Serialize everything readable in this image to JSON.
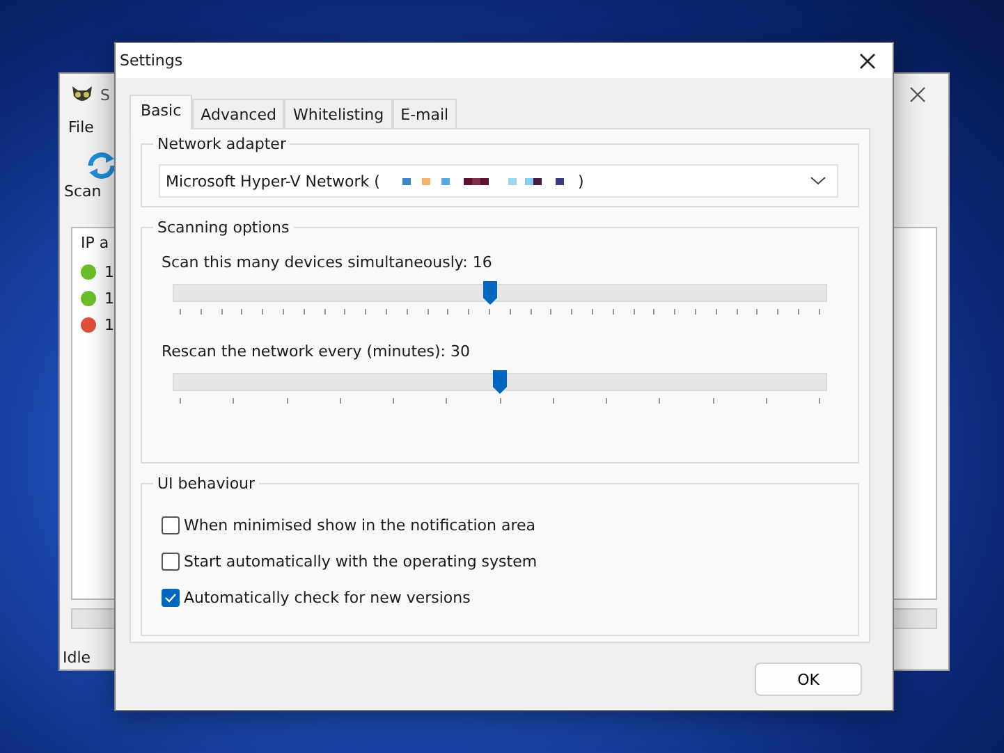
{
  "back_window": {
    "title": "S",
    "menu": [
      "File"
    ],
    "toolbar": {
      "label": "Scan"
    },
    "list": {
      "column_1": "IP a",
      "rows": [
        {
          "text": "1",
          "color": "#6cbf2a"
        },
        {
          "text": "1",
          "color": "#6cbf2a"
        },
        {
          "text": "1",
          "color": "#e0513c"
        }
      ]
    },
    "progress": {
      "level": 0
    },
    "status_bar": "Idle"
  },
  "dialog": {
    "title": "Settings",
    "tabs": [
      {
        "label": "Basic",
        "selected": true
      },
      {
        "label": "Advanced",
        "selected": false
      },
      {
        "label": "Whitelisting",
        "selected": false
      },
      {
        "label": "E-mail",
        "selected": false
      }
    ],
    "network_adapter": {
      "heading": "Network adapter",
      "value_start": "Microsoft Hyper-V Network (",
      "value_end": ")"
    },
    "scanning_options": {
      "heading": "Scanning options",
      "sliders": [
        {
          "label": "Scan this many devices simultaneously: 16",
          "level": 0.485
        },
        {
          "label": "Rescan the network every (minutes): 30",
          "level": 0.5
        }
      ]
    },
    "ui_behaviour": {
      "heading": "UI behaviour",
      "options": [
        {
          "label": "When minimised show in the notification area",
          "checked": false
        },
        {
          "label": "Start automatically with the operating system",
          "checked": false
        },
        {
          "label": "Automatically check for new versions",
          "checked": true
        }
      ]
    },
    "buttons": [
      "OK"
    ]
  }
}
